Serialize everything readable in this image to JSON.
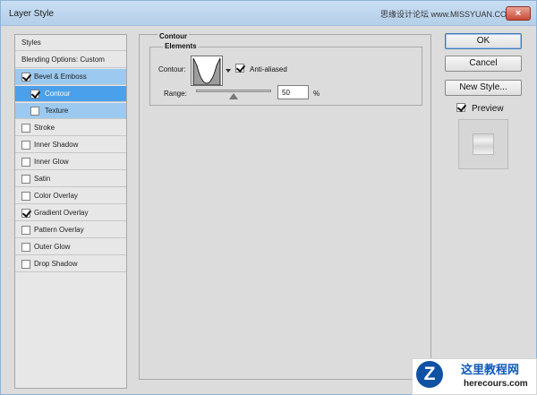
{
  "window": {
    "title": "Layer Style",
    "watermark": "思缘设计论坛 www.MISSYUAN.COM",
    "close_icon": "×"
  },
  "styles_panel": {
    "header": "Styles",
    "items": [
      {
        "label": "Blending Options: Custom",
        "checked": null,
        "state": "normal"
      },
      {
        "label": "Bevel & Emboss",
        "checked": true,
        "state": "light"
      },
      {
        "label": "Contour",
        "checked": true,
        "state": "dark"
      },
      {
        "label": "Texture",
        "checked": false,
        "state": "light"
      },
      {
        "label": "Stroke",
        "checked": false,
        "state": "normal"
      },
      {
        "label": "Inner Shadow",
        "checked": false,
        "state": "normal"
      },
      {
        "label": "Inner Glow",
        "checked": false,
        "state": "normal"
      },
      {
        "label": "Satin",
        "checked": false,
        "state": "normal"
      },
      {
        "label": "Color Overlay",
        "checked": false,
        "state": "normal"
      },
      {
        "label": "Gradient Overlay",
        "checked": true,
        "state": "normal"
      },
      {
        "label": "Pattern Overlay",
        "checked": false,
        "state": "normal"
      },
      {
        "label": "Outer Glow",
        "checked": false,
        "state": "normal"
      },
      {
        "label": "Drop Shadow",
        "checked": false,
        "state": "normal"
      }
    ]
  },
  "contour": {
    "section_title": "Contour",
    "group_title": "Elements",
    "contour_label": "Contour:",
    "anti_aliased_label": "Anti-aliased",
    "anti_aliased": true,
    "range_label": "Range:",
    "range_value": "50",
    "range_unit": "%"
  },
  "buttons": {
    "ok": "OK",
    "cancel": "Cancel",
    "new_style": "New Style..."
  },
  "preview": {
    "label": "Preview",
    "checked": true
  },
  "watermark_bottom": {
    "logo_letter": "Z",
    "title": "这里教程网",
    "url": "herecours.com"
  }
}
